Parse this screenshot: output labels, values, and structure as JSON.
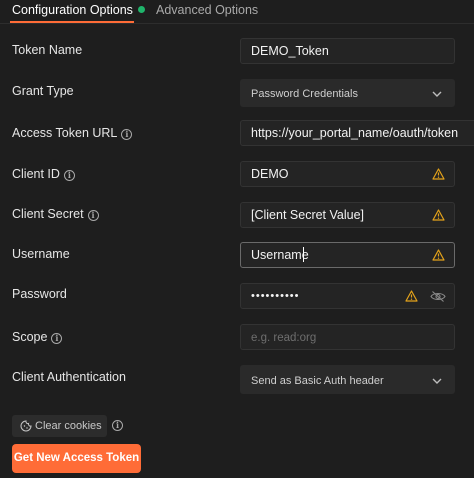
{
  "tabs": [
    {
      "label": "Configuration Options",
      "active": true
    },
    {
      "label": "Advanced Options",
      "active": false
    }
  ],
  "fields": {
    "token_name": {
      "label": "Token Name",
      "value": "DEMO_Token"
    },
    "grant_type": {
      "label": "Grant Type",
      "value": "Password Credentials"
    },
    "access_token_url": {
      "label": "Access Token URL",
      "value": "https://your_portal_name/oauth/token"
    },
    "client_id": {
      "label": "Client ID",
      "value": "DEMO"
    },
    "client_secret": {
      "label": "Client Secret",
      "value": "[Client Secret Value]"
    },
    "username": {
      "label": "Username",
      "value": "Username"
    },
    "password": {
      "label": "Password",
      "value": "••••••••••"
    },
    "scope": {
      "label": "Scope",
      "placeholder": "e.g. read:org"
    },
    "client_authentication": {
      "label": "Client Authentication",
      "value": "Send as Basic Auth header"
    }
  },
  "buttons": {
    "clear_cookies": "Clear cookies",
    "get_token": "Get New Access Token"
  },
  "icons": {
    "info": "i",
    "warning": "warning-icon",
    "eye": "eye-slash-icon",
    "chevron": "chevron-down-icon",
    "cookie": "cookie-icon"
  },
  "colors": {
    "accent": "#ff6c37",
    "status_dot": "#1fb46b",
    "warning": "#e3a21a",
    "background": "#1e1e1e"
  }
}
